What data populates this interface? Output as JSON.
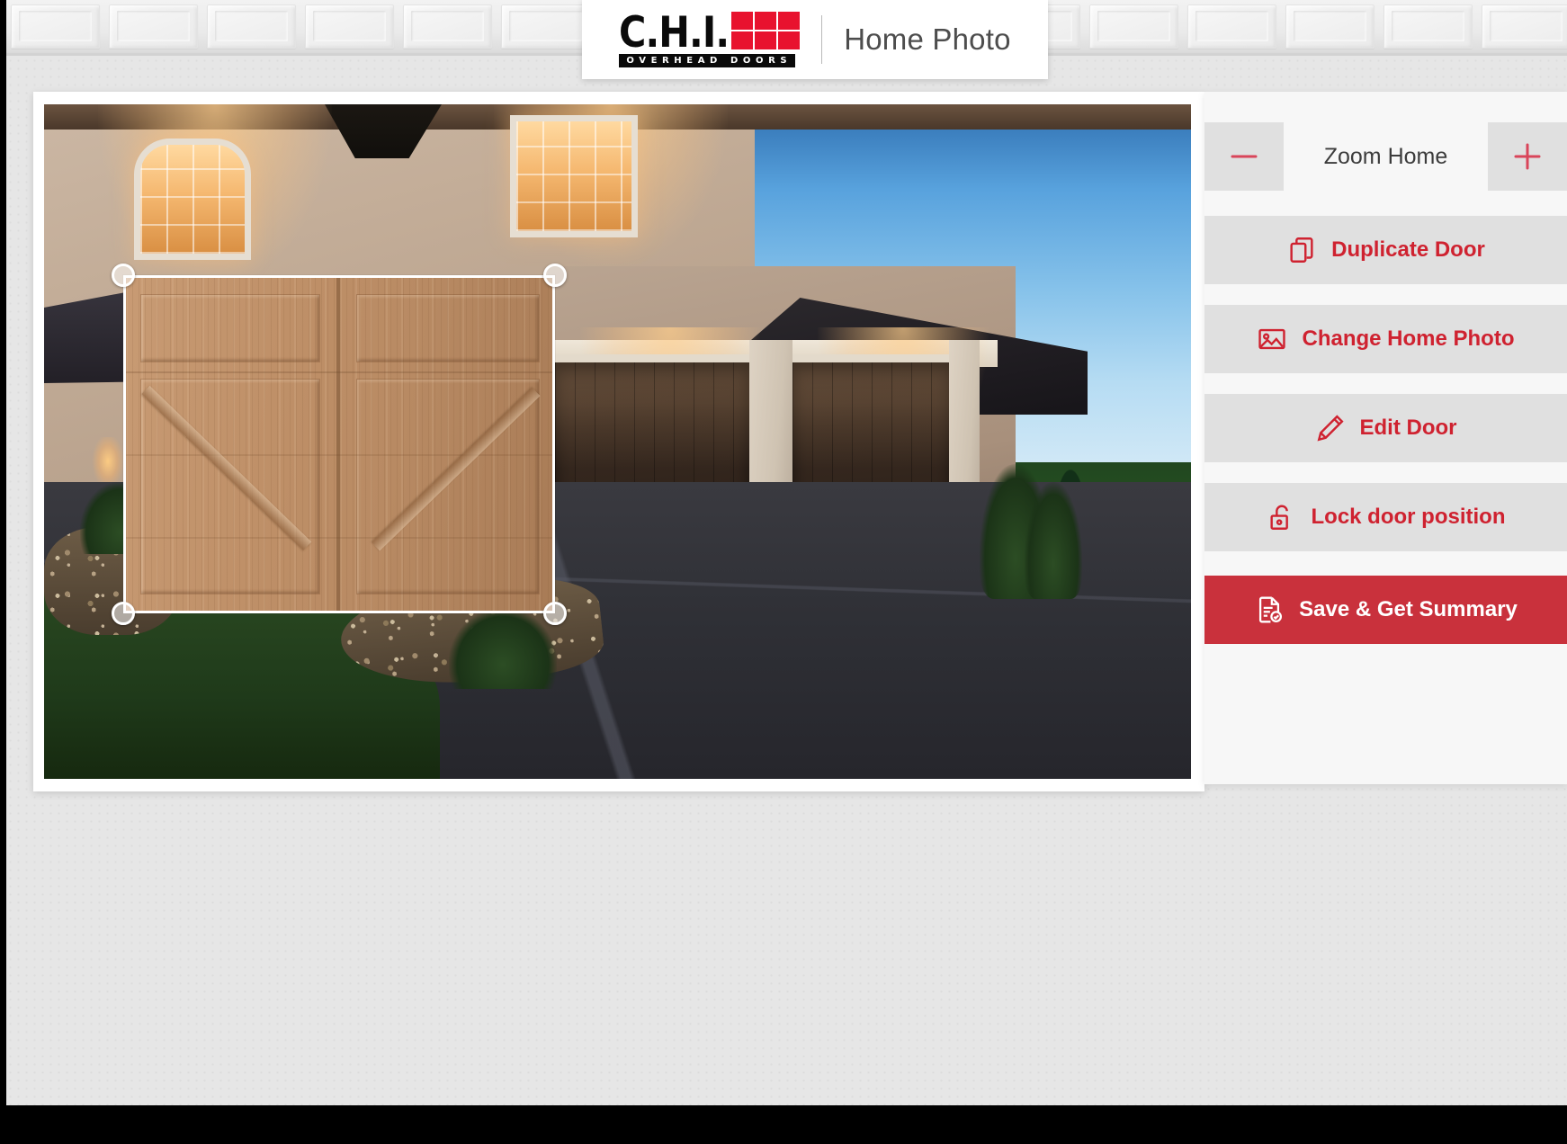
{
  "brand": {
    "logo_text": "C.H.I.",
    "logo_subtext": "OVERHEAD DOORS",
    "title": "Home Photo",
    "accent_red": "#e8122e",
    "grid_icon": "chi-grid-icon"
  },
  "photo": {
    "alt_name": "home-photo-canvas",
    "description": "Two-story stucco home at dusk with two dark garage bays, lit windows, driveway and landscaping"
  },
  "door_overlay": {
    "name": "selected-door-overlay",
    "style": "carriage-house-crossbuck-wood",
    "handles": [
      "top-left",
      "top-right",
      "bottom-left",
      "bottom-right"
    ]
  },
  "panel": {
    "zoom": {
      "label": "Zoom Home",
      "minus_label": "−",
      "plus_label": "+",
      "minus_icon": "minus-icon",
      "plus_icon": "plus-icon"
    },
    "buttons": [
      {
        "label": "Duplicate Door",
        "icon": "copy-icon",
        "style": "secondary"
      },
      {
        "label": "Change Home Photo",
        "icon": "image-icon",
        "style": "secondary"
      },
      {
        "label": "Edit Door",
        "icon": "pencil-icon",
        "style": "secondary"
      },
      {
        "label": "Lock door position",
        "icon": "unlock-icon",
        "style": "secondary"
      },
      {
        "label": "Save & Get Summary",
        "icon": "document-check-icon",
        "style": "primary"
      }
    ],
    "colors": {
      "button_bg": "#e0e0e0",
      "button_text": "#cf2230",
      "primary_bg": "#c9313c",
      "primary_text": "#ffffff",
      "panel_bg": "#f7f7f7"
    }
  }
}
